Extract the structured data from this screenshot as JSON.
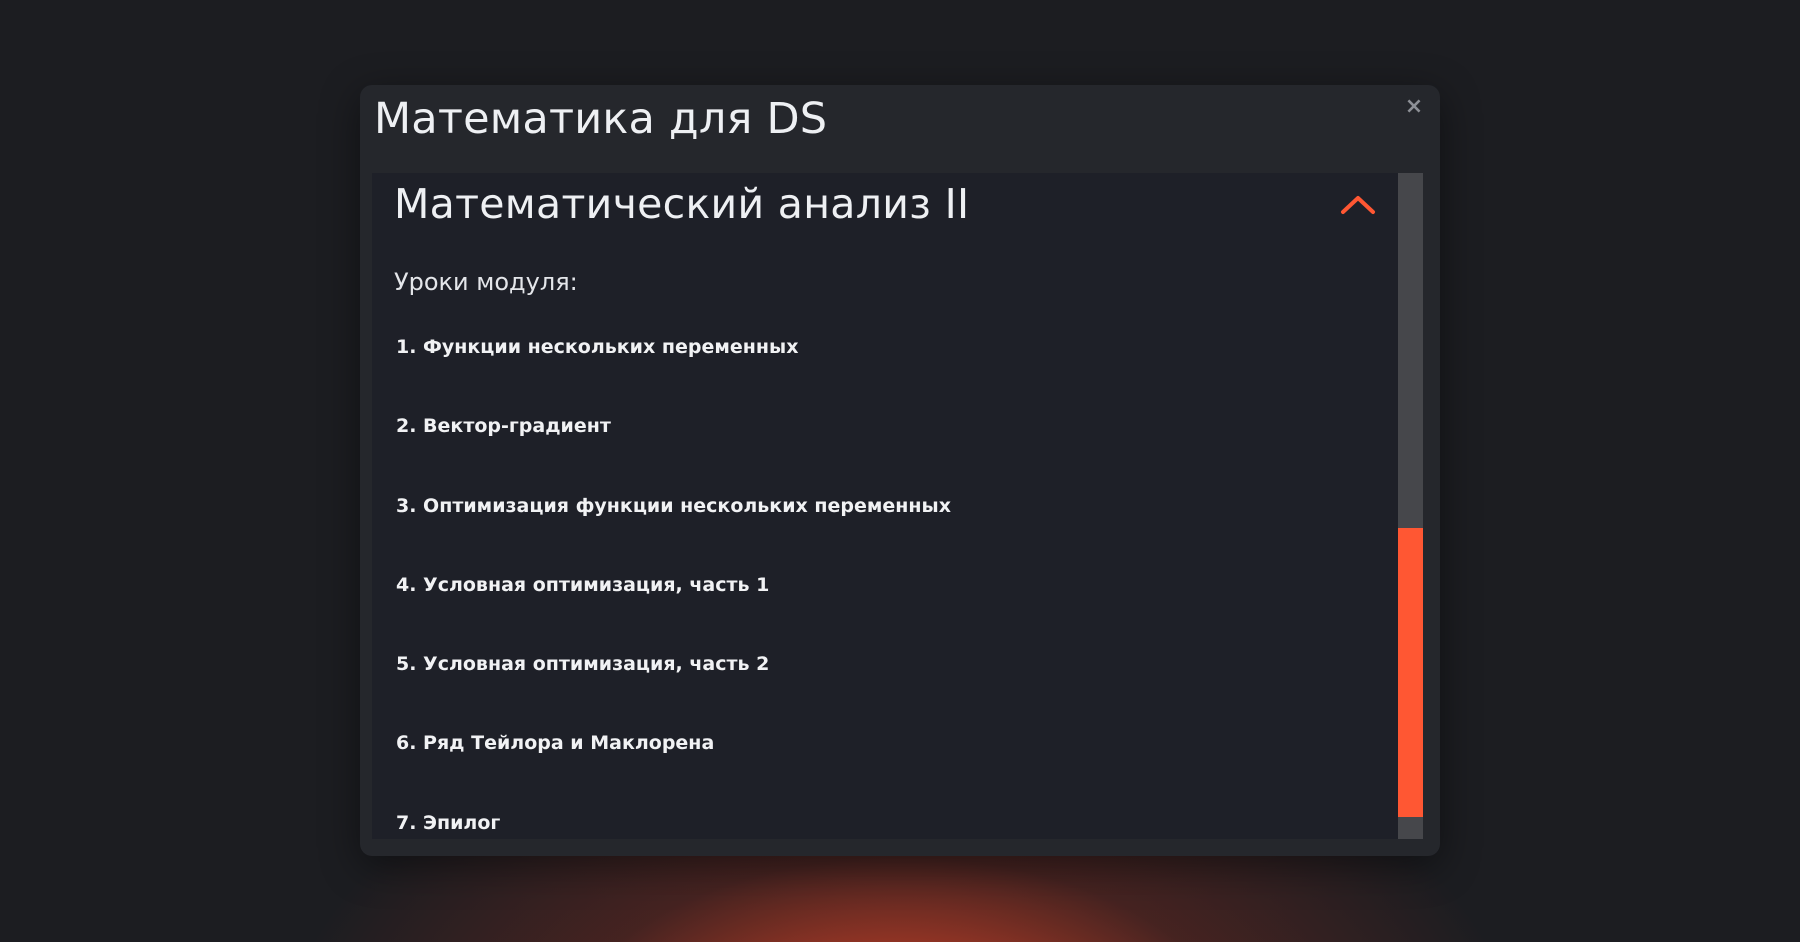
{
  "modal": {
    "title": "Математика для DS",
    "close_icon": "×"
  },
  "section": {
    "title": "Математический анализ II",
    "expanded": true,
    "chevron_color": "#ff5733"
  },
  "lessons": {
    "label": "Уроки модуля:",
    "items": [
      "1. Функции нескольких переменных",
      "2. Вектор-градиент",
      "3. Оптимизация функции нескольких переменных",
      "4. Условная оптимизация, часть 1",
      "5. Условная оптимизация, часть 2",
      "6. Ряд Тейлора и Маклорена",
      "7. Эпилог"
    ]
  },
  "scrollbar": {
    "thumb_color": "#ff5733",
    "track_color": "#46474b"
  }
}
